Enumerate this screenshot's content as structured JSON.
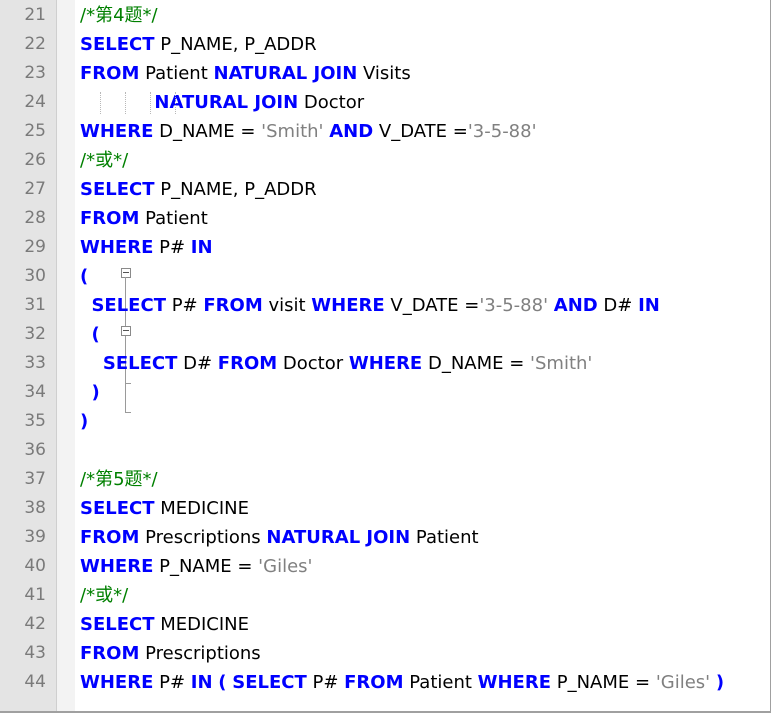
{
  "editor": {
    "lines": [
      {
        "n": "21",
        "tokens": [
          {
            "t": "cm",
            "v": "/*第4题*/"
          }
        ]
      },
      {
        "n": "22",
        "tokens": [
          {
            "t": "kw",
            "v": "SELECT"
          },
          {
            "t": "tx",
            "v": " P_NAME, P_ADDR"
          }
        ]
      },
      {
        "n": "23",
        "tokens": [
          {
            "t": "kw",
            "v": "FROM"
          },
          {
            "t": "tx",
            "v": " Patient "
          },
          {
            "t": "kw",
            "v": "NATURAL JOIN"
          },
          {
            "t": "tx",
            "v": " Visits"
          }
        ]
      },
      {
        "n": "24",
        "tokens": [
          {
            "t": "tx",
            "v": "             "
          },
          {
            "t": "kw",
            "v": "NATURAL JOIN"
          },
          {
            "t": "tx",
            "v": " Doctor"
          }
        ]
      },
      {
        "n": "25",
        "tokens": [
          {
            "t": "kw",
            "v": "WHERE"
          },
          {
            "t": "tx",
            "v": " D_NAME = "
          },
          {
            "t": "str",
            "v": "'Smith'"
          },
          {
            "t": "tx",
            "v": " "
          },
          {
            "t": "kw",
            "v": "AND"
          },
          {
            "t": "tx",
            "v": " V_DATE ="
          },
          {
            "t": "str",
            "v": "'3-5-88'"
          }
        ]
      },
      {
        "n": "26",
        "tokens": [
          {
            "t": "cm",
            "v": "/*或*/"
          }
        ]
      },
      {
        "n": "27",
        "tokens": [
          {
            "t": "kw",
            "v": "SELECT"
          },
          {
            "t": "tx",
            "v": " P_NAME, P_ADDR"
          }
        ]
      },
      {
        "n": "28",
        "tokens": [
          {
            "t": "kw",
            "v": "FROM"
          },
          {
            "t": "tx",
            "v": " Patient"
          }
        ]
      },
      {
        "n": "29",
        "tokens": [
          {
            "t": "kw",
            "v": "WHERE"
          },
          {
            "t": "tx",
            "v": " P# "
          },
          {
            "t": "kw",
            "v": "IN"
          }
        ]
      },
      {
        "n": "30",
        "tokens": [
          {
            "t": "kw",
            "v": "("
          }
        ]
      },
      {
        "n": "31",
        "tokens": [
          {
            "t": "tx",
            "v": "  "
          },
          {
            "t": "kw",
            "v": "SELECT"
          },
          {
            "t": "tx",
            "v": " P# "
          },
          {
            "t": "kw",
            "v": "FROM"
          },
          {
            "t": "tx",
            "v": " visit "
          },
          {
            "t": "kw",
            "v": "WHERE"
          },
          {
            "t": "tx",
            "v": " V_DATE ="
          },
          {
            "t": "str",
            "v": "'3-5-88'"
          },
          {
            "t": "tx",
            "v": " "
          },
          {
            "t": "kw",
            "v": "AND"
          },
          {
            "t": "tx",
            "v": " D# "
          },
          {
            "t": "kw",
            "v": "IN"
          }
        ]
      },
      {
        "n": "32",
        "tokens": [
          {
            "t": "tx",
            "v": "  "
          },
          {
            "t": "kw",
            "v": "("
          }
        ]
      },
      {
        "n": "33",
        "tokens": [
          {
            "t": "tx",
            "v": "    "
          },
          {
            "t": "kw",
            "v": "SELECT"
          },
          {
            "t": "tx",
            "v": " D# "
          },
          {
            "t": "kw",
            "v": "FROM"
          },
          {
            "t": "tx",
            "v": " Doctor "
          },
          {
            "t": "kw",
            "v": "WHERE"
          },
          {
            "t": "tx",
            "v": " D_NAME = "
          },
          {
            "t": "str",
            "v": "'Smith'"
          }
        ]
      },
      {
        "n": "34",
        "tokens": [
          {
            "t": "tx",
            "v": "  "
          },
          {
            "t": "kw",
            "v": ")"
          }
        ]
      },
      {
        "n": "35",
        "tokens": [
          {
            "t": "kw",
            "v": ")"
          }
        ]
      },
      {
        "n": "36",
        "tokens": []
      },
      {
        "n": "37",
        "tokens": [
          {
            "t": "cm",
            "v": "/*第5题*/"
          }
        ]
      },
      {
        "n": "38",
        "tokens": [
          {
            "t": "kw",
            "v": "SELECT"
          },
          {
            "t": "tx",
            "v": " MEDICINE"
          }
        ]
      },
      {
        "n": "39",
        "tokens": [
          {
            "t": "kw",
            "v": "FROM"
          },
          {
            "t": "tx",
            "v": " Prescriptions "
          },
          {
            "t": "kw",
            "v": "NATURAL JOIN"
          },
          {
            "t": "tx",
            "v": " Patient"
          }
        ]
      },
      {
        "n": "40",
        "tokens": [
          {
            "t": "kw",
            "v": "WHERE"
          },
          {
            "t": "tx",
            "v": " P_NAME = "
          },
          {
            "t": "str",
            "v": "'Giles'"
          }
        ]
      },
      {
        "n": "41",
        "tokens": [
          {
            "t": "cm",
            "v": "/*或*/"
          }
        ]
      },
      {
        "n": "42",
        "tokens": [
          {
            "t": "kw",
            "v": "SELECT"
          },
          {
            "t": "tx",
            "v": " MEDICINE"
          }
        ]
      },
      {
        "n": "43",
        "tokens": [
          {
            "t": "kw",
            "v": "FROM"
          },
          {
            "t": "tx",
            "v": " Prescriptions"
          }
        ]
      },
      {
        "n": "44",
        "tokens": [
          {
            "t": "kw",
            "v": "WHERE"
          },
          {
            "t": "tx",
            "v": " P# "
          },
          {
            "t": "kw",
            "v": "IN"
          },
          {
            "t": "tx",
            "v": " "
          },
          {
            "t": "kw",
            "v": "("
          },
          {
            "t": "tx",
            "v": " "
          },
          {
            "t": "kw",
            "v": "SELECT"
          },
          {
            "t": "tx",
            "v": " P# "
          },
          {
            "t": "kw",
            "v": "FROM"
          },
          {
            "t": "tx",
            "v": " Patient "
          },
          {
            "t": "kw",
            "v": "WHERE"
          },
          {
            "t": "tx",
            "v": " P_NAME = "
          },
          {
            "t": "str",
            "v": "'Giles'"
          },
          {
            "t": "tx",
            "v": " "
          },
          {
            "t": "kw",
            "v": ")"
          }
        ]
      }
    ],
    "colors": {
      "keyword": "#0000ff",
      "string": "#808080",
      "comment": "#008000",
      "text": "#000000",
      "line_number": "#7a7a7a",
      "gutter": "#e4e4e4"
    }
  }
}
